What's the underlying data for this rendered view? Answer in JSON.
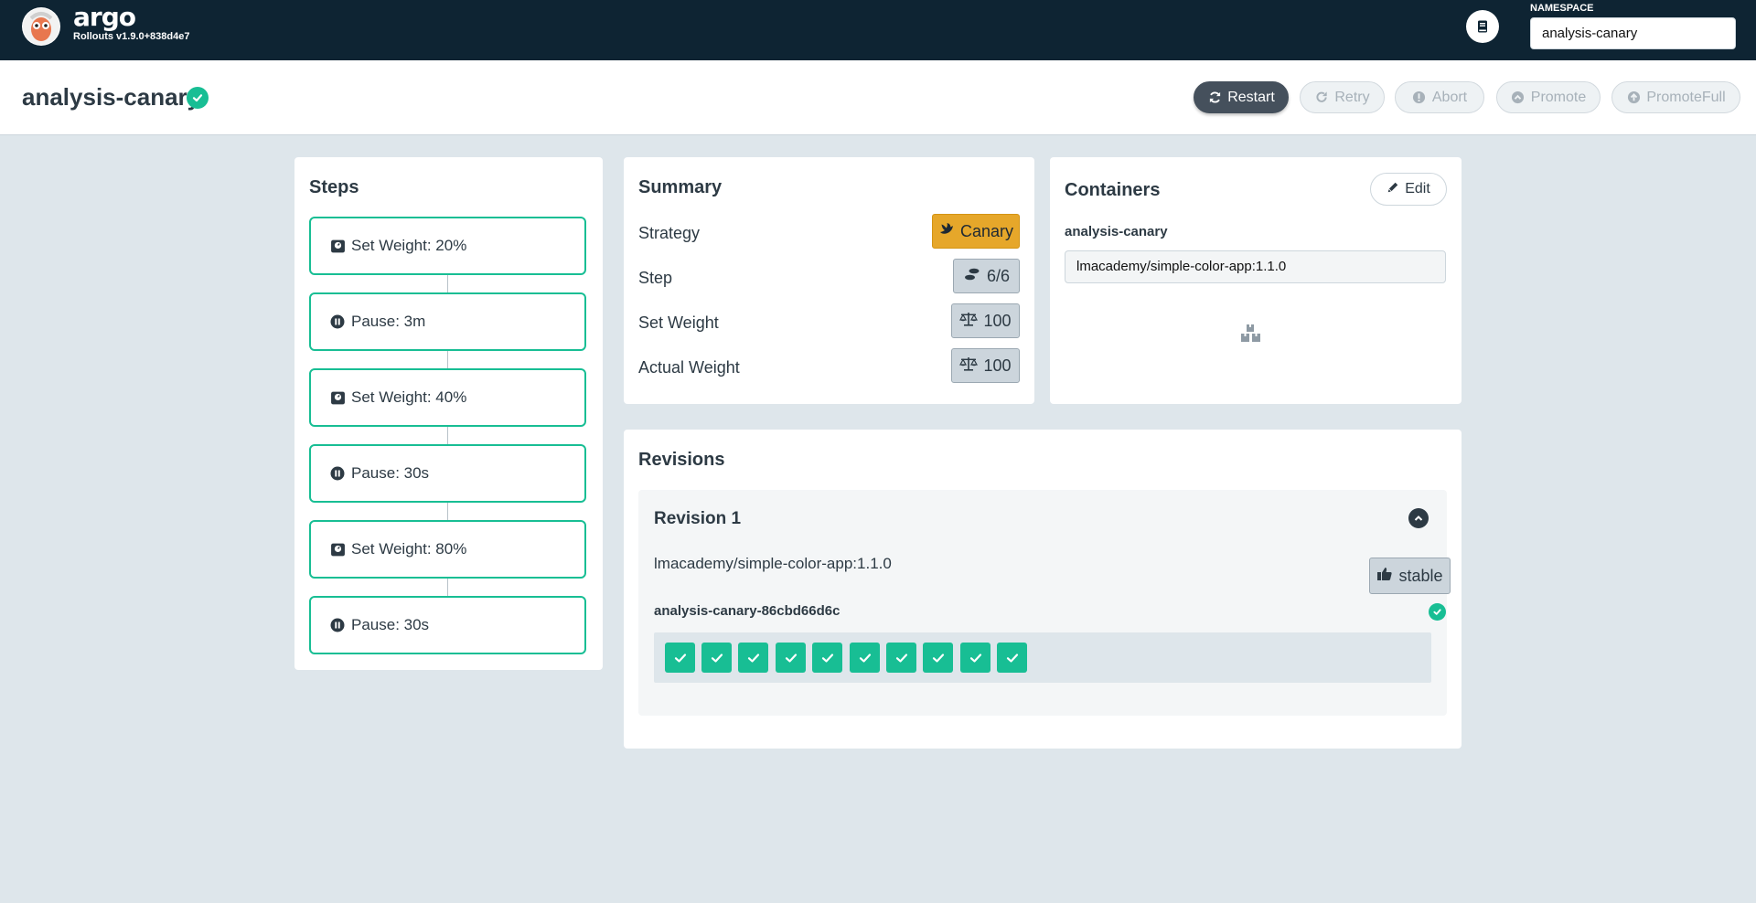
{
  "topbar": {
    "brand": "argo",
    "version": "Rollouts v1.9.0+838d4e7",
    "namespace_label": "NAMESPACE",
    "namespace_value": "analysis-canary"
  },
  "header": {
    "title": "analysis-canary",
    "buttons": {
      "restart": "Restart",
      "retry": "Retry",
      "abort": "Abort",
      "promote": "Promote",
      "promote_full": "PromoteFull"
    }
  },
  "steps": {
    "title": "Steps",
    "items": [
      {
        "label": "Set Weight: 20%",
        "icon": "weight-icon"
      },
      {
        "label": "Pause: 3m",
        "icon": "pause-icon"
      },
      {
        "label": "Set Weight: 40%",
        "icon": "weight-icon"
      },
      {
        "label": "Pause: 30s",
        "icon": "pause-icon"
      },
      {
        "label": "Set Weight: 80%",
        "icon": "weight-icon"
      },
      {
        "label": "Pause: 30s",
        "icon": "pause-icon"
      }
    ]
  },
  "summary": {
    "title": "Summary",
    "strategy_label": "Strategy",
    "strategy_value": "Canary",
    "step_label": "Step",
    "step_value": "6/6",
    "set_weight_label": "Set Weight",
    "set_weight_value": "100",
    "actual_weight_label": "Actual Weight",
    "actual_weight_value": "100"
  },
  "containers": {
    "title": "Containers",
    "edit_label": "Edit",
    "name": "analysis-canary",
    "image": "lmacademy/simple-color-app:1.1.0"
  },
  "revisions": {
    "title": "Revisions",
    "items": [
      {
        "title": "Revision 1",
        "image": "lmacademy/simple-color-app:1.1.0",
        "badge": "stable",
        "replicaset": "analysis-canary-86cbd66d6c",
        "pods_ready": 10
      }
    ]
  },
  "colors": {
    "topbar": "#0e2433",
    "success": "#18be94",
    "canary": "#e6a72a",
    "primary_button": "#45505c",
    "background": "#dee6eb"
  }
}
